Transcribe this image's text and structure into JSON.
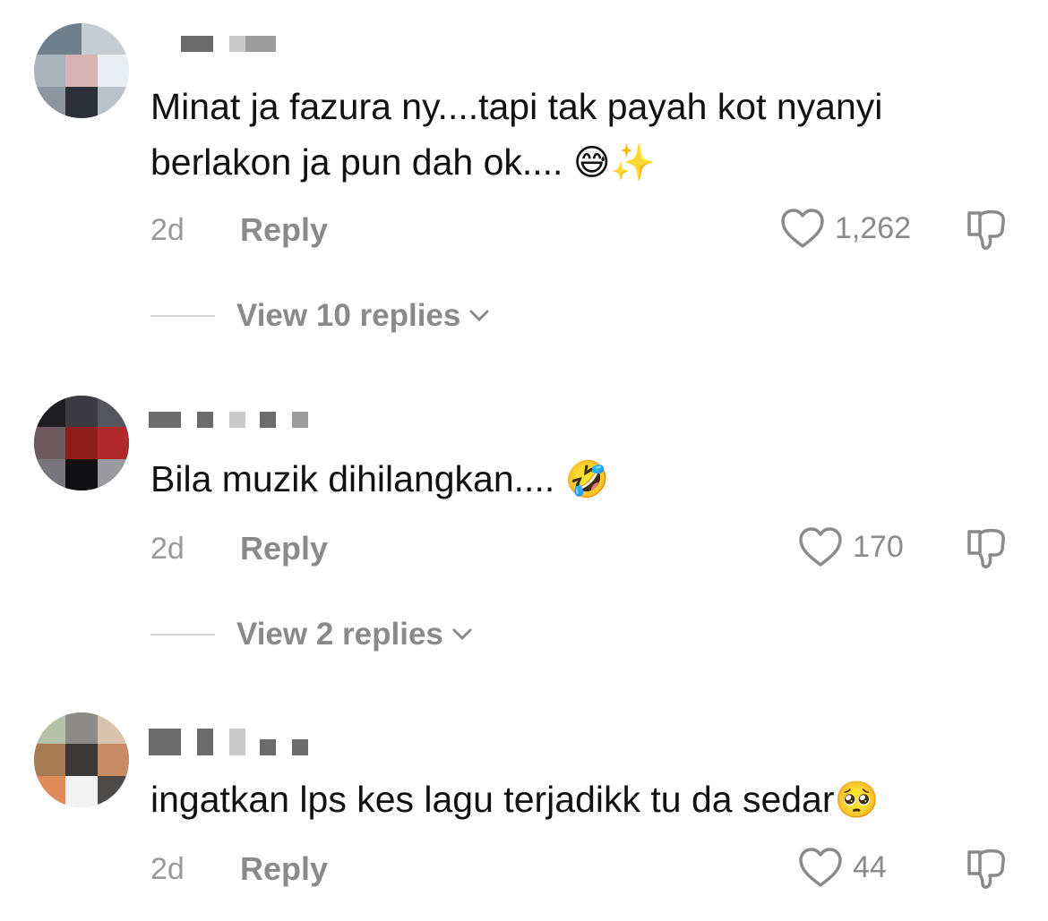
{
  "comments": [
    {
      "text": "Minat ja fazura ny....tapi tak payah kot nyanyi berlakon ja pun dah ok....",
      "emoji": "😅✨",
      "time": "2d",
      "reply_label": "Reply",
      "likes": "1,262",
      "view_replies": "View 10 replies"
    },
    {
      "text": "Bila muzik dihilangkan....",
      "emoji": "🤣",
      "time": "2d",
      "reply_label": "Reply",
      "likes": "170",
      "view_replies": "View 2 replies"
    },
    {
      "text": "ingatkan lps kes lagu terjadikk tu da sedar",
      "emoji": "🥺",
      "time": "2d",
      "reply_label": "Reply",
      "likes": "44"
    }
  ],
  "icons": {
    "like": "heart-outline-icon",
    "dislike": "thumbs-down-icon",
    "expand": "chevron-down-icon"
  },
  "colors": {
    "text": "#111111",
    "muted": "#8a8a8a",
    "divider": "#d4d4d4"
  }
}
